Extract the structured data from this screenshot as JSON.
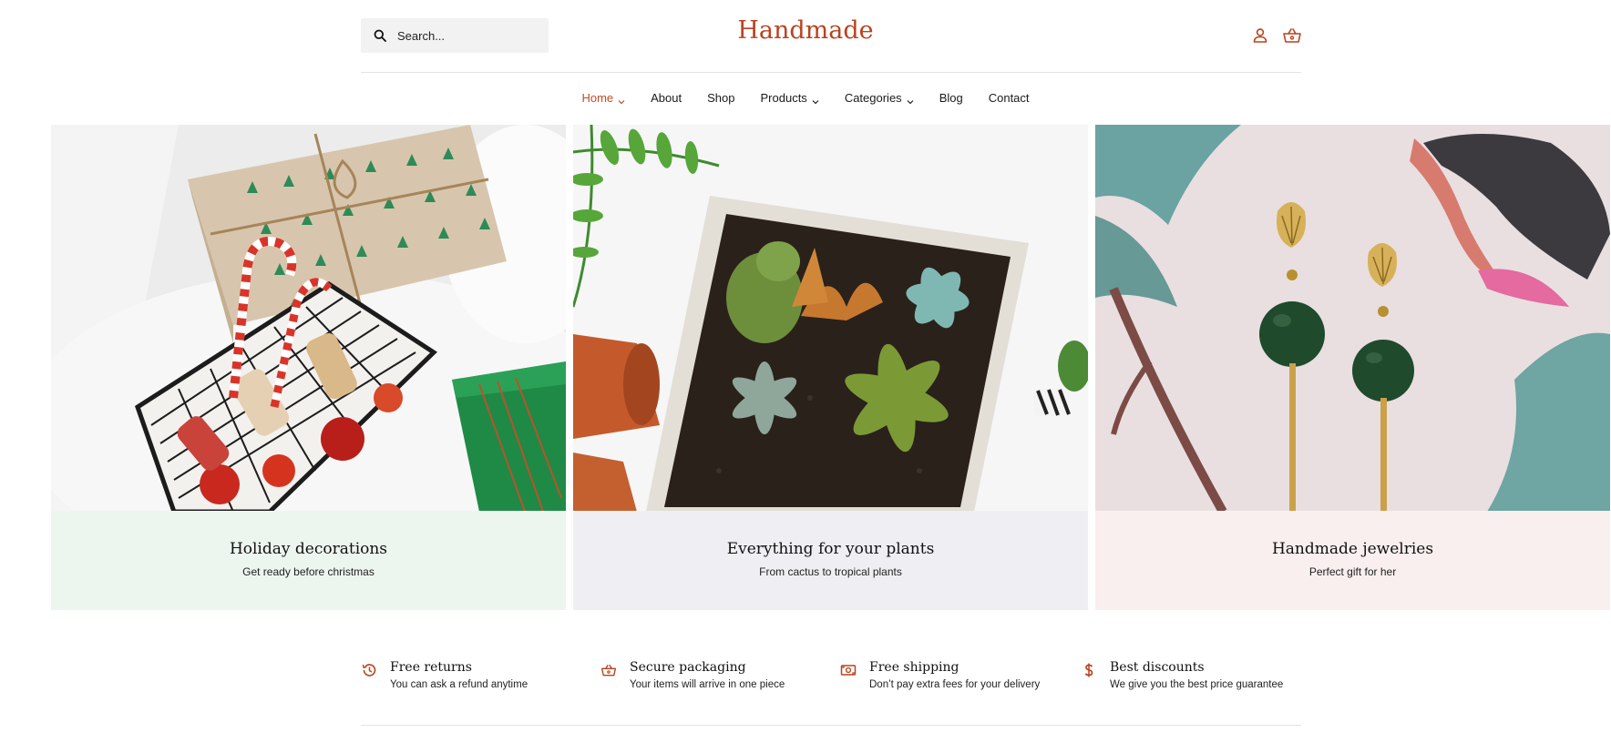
{
  "brand": {
    "name": "Handmade",
    "accent": "#b8431f"
  },
  "search": {
    "placeholder": "Search..."
  },
  "header_icons": [
    "user-icon",
    "basket-icon"
  ],
  "nav": {
    "items": [
      {
        "label": "Home",
        "dropdown": true,
        "active": true
      },
      {
        "label": "About",
        "dropdown": false
      },
      {
        "label": "Shop",
        "dropdown": false
      },
      {
        "label": "Products",
        "dropdown": true
      },
      {
        "label": "Categories",
        "dropdown": true
      },
      {
        "label": "Blog",
        "dropdown": false
      },
      {
        "label": "Contact",
        "dropdown": false
      }
    ]
  },
  "hero_cards": [
    {
      "title": "Holiday decorations",
      "subtitle": "Get ready before christmas",
      "caption_bg": "#edf5ef"
    },
    {
      "title": "Everything for your plants",
      "subtitle": "From cactus to tropical plants",
      "caption_bg": "#efeff3"
    },
    {
      "title": "Handmade jewelries",
      "subtitle": "Perfect gift for her",
      "caption_bg": "#f8efee"
    }
  ],
  "features": [
    {
      "icon": "history-icon",
      "title": "Free returns",
      "subtitle": "You can ask a refund anytime"
    },
    {
      "icon": "basket-icon",
      "title": "Secure packaging",
      "subtitle": "Your items will arrive in one piece"
    },
    {
      "icon": "money-icon",
      "title": "Free shipping",
      "subtitle": "Don’t pay extra fees for your delivery"
    },
    {
      "icon": "dollar-icon",
      "title": "Best discounts",
      "subtitle": "We give you the best price guarantee"
    }
  ]
}
